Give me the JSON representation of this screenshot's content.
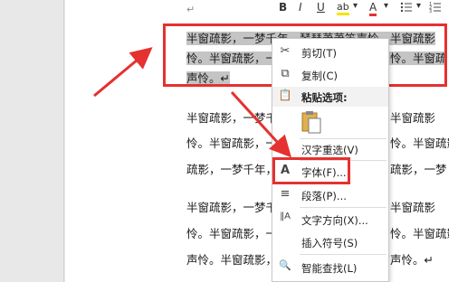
{
  "document": {
    "para_mark": "↵",
    "selected_lines": [
      "半窗疏影，一梦千年，琴瑟萧萧笛声怜。半窗疏影",
      "怜。半窗疏影，一梦千年，琴瑟萧萧笛声怜。半窗疏",
      "声怜。↵"
    ],
    "lines": [
      "半窗疏影，一梦千年，琴瑟萧萧笛声怜。半窗疏影",
      "怜。半窗疏影，一梦千年，琴瑟萧萧笛声怜。半窗疏影，一梦",
      "疏影，一梦千年，琴瑟萧萧笛声怜。半窗疏影，一梦",
      "半窗疏影，一梦千年，琴瑟萧萧笛声怜。半窗疏影",
      "怜。半窗疏影，一梦千年，琴瑟萧萧笛声怜。半窗疏影",
      "声怜。半窗疏影，一梦千年，琴瑟萧萧笛声怜。↵"
    ]
  },
  "mini_toolbar": {
    "bold": "B",
    "italic": "I",
    "underline": "U",
    "highlight": "ab",
    "font_color": "A",
    "dropdown": "▾"
  },
  "context_menu": {
    "items": [
      {
        "label": "剪切(T)",
        "icon": "scissors-icon",
        "glyph": "✂"
      },
      {
        "label": "复制(C)",
        "icon": "copy-icon",
        "glyph": "⧉"
      },
      {
        "label": "粘贴选项:",
        "icon": "paste-icon",
        "glyph": "📋"
      },
      {
        "label": "汉字重选(V)",
        "icon": "",
        "glyph": ""
      },
      {
        "label": "字体(F)...",
        "icon": "font-icon",
        "glyph": "A"
      },
      {
        "label": "段落(P)...",
        "icon": "paragraph-icon",
        "glyph": "≡"
      },
      {
        "label": "文字方向(X)...",
        "icon": "text-direction-icon",
        "glyph": "‖A"
      },
      {
        "label": "插入符号(S)",
        "icon": "",
        "glyph": ""
      },
      {
        "label": "智能查找(L)",
        "icon": "search-icon",
        "glyph": "🔍"
      }
    ]
  },
  "colors": {
    "annotation_red": "#e5312f",
    "selection_gray": "#c4c4c4"
  }
}
